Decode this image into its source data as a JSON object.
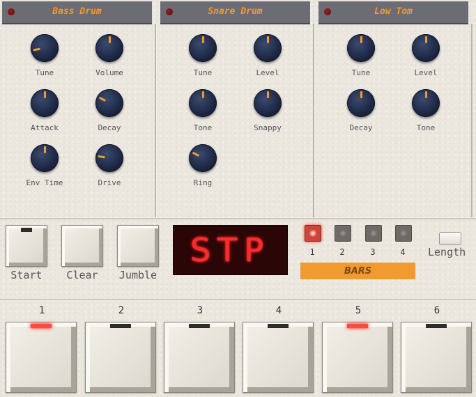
{
  "colors": {
    "accent": "#f39a2a",
    "header": "#6c6c74",
    "knob": "#1a2440",
    "display_text": "#ff2a2a"
  },
  "instruments": [
    {
      "title": "Bass Drum",
      "knobs": [
        {
          "label": "Tune",
          "level": 0.13
        },
        {
          "label": "Volume",
          "level": 0.5
        },
        {
          "label": "Attack",
          "level": 0.5
        },
        {
          "label": "Decay",
          "level": 0.27
        },
        {
          "label": "Env Time",
          "level": 0.5
        },
        {
          "label": "Drive",
          "level": 0.2
        }
      ]
    },
    {
      "title": "Snare Drum",
      "knobs": [
        {
          "label": "Tune",
          "level": 0.5
        },
        {
          "label": "Level",
          "level": 0.5
        },
        {
          "label": "Tone",
          "level": 0.5
        },
        {
          "label": "Snappy",
          "level": 0.5
        },
        {
          "label": "Ring",
          "level": 0.27
        }
      ]
    },
    {
      "title": "Low Tom",
      "knobs": [
        {
          "label": "Tune",
          "level": 0.5
        },
        {
          "label": "Level",
          "level": 0.5
        },
        {
          "label": "Decay",
          "level": 0.5
        },
        {
          "label": "Tone",
          "level": 0.5
        }
      ]
    }
  ],
  "controls": {
    "start": "Start",
    "clear": "Clear",
    "jumble": "Jumble"
  },
  "display": "STP",
  "bars": {
    "label": "BARS",
    "items": [
      {
        "num": "1",
        "on": true
      },
      {
        "num": "2",
        "on": false
      },
      {
        "num": "3",
        "on": false
      },
      {
        "num": "4",
        "on": false
      }
    ]
  },
  "length_label": "Length",
  "steps": [
    {
      "num": "1",
      "lit": true
    },
    {
      "num": "2",
      "lit": false
    },
    {
      "num": "3",
      "lit": false
    },
    {
      "num": "4",
      "lit": false
    },
    {
      "num": "5",
      "lit": true
    },
    {
      "num": "6",
      "lit": false
    }
  ]
}
